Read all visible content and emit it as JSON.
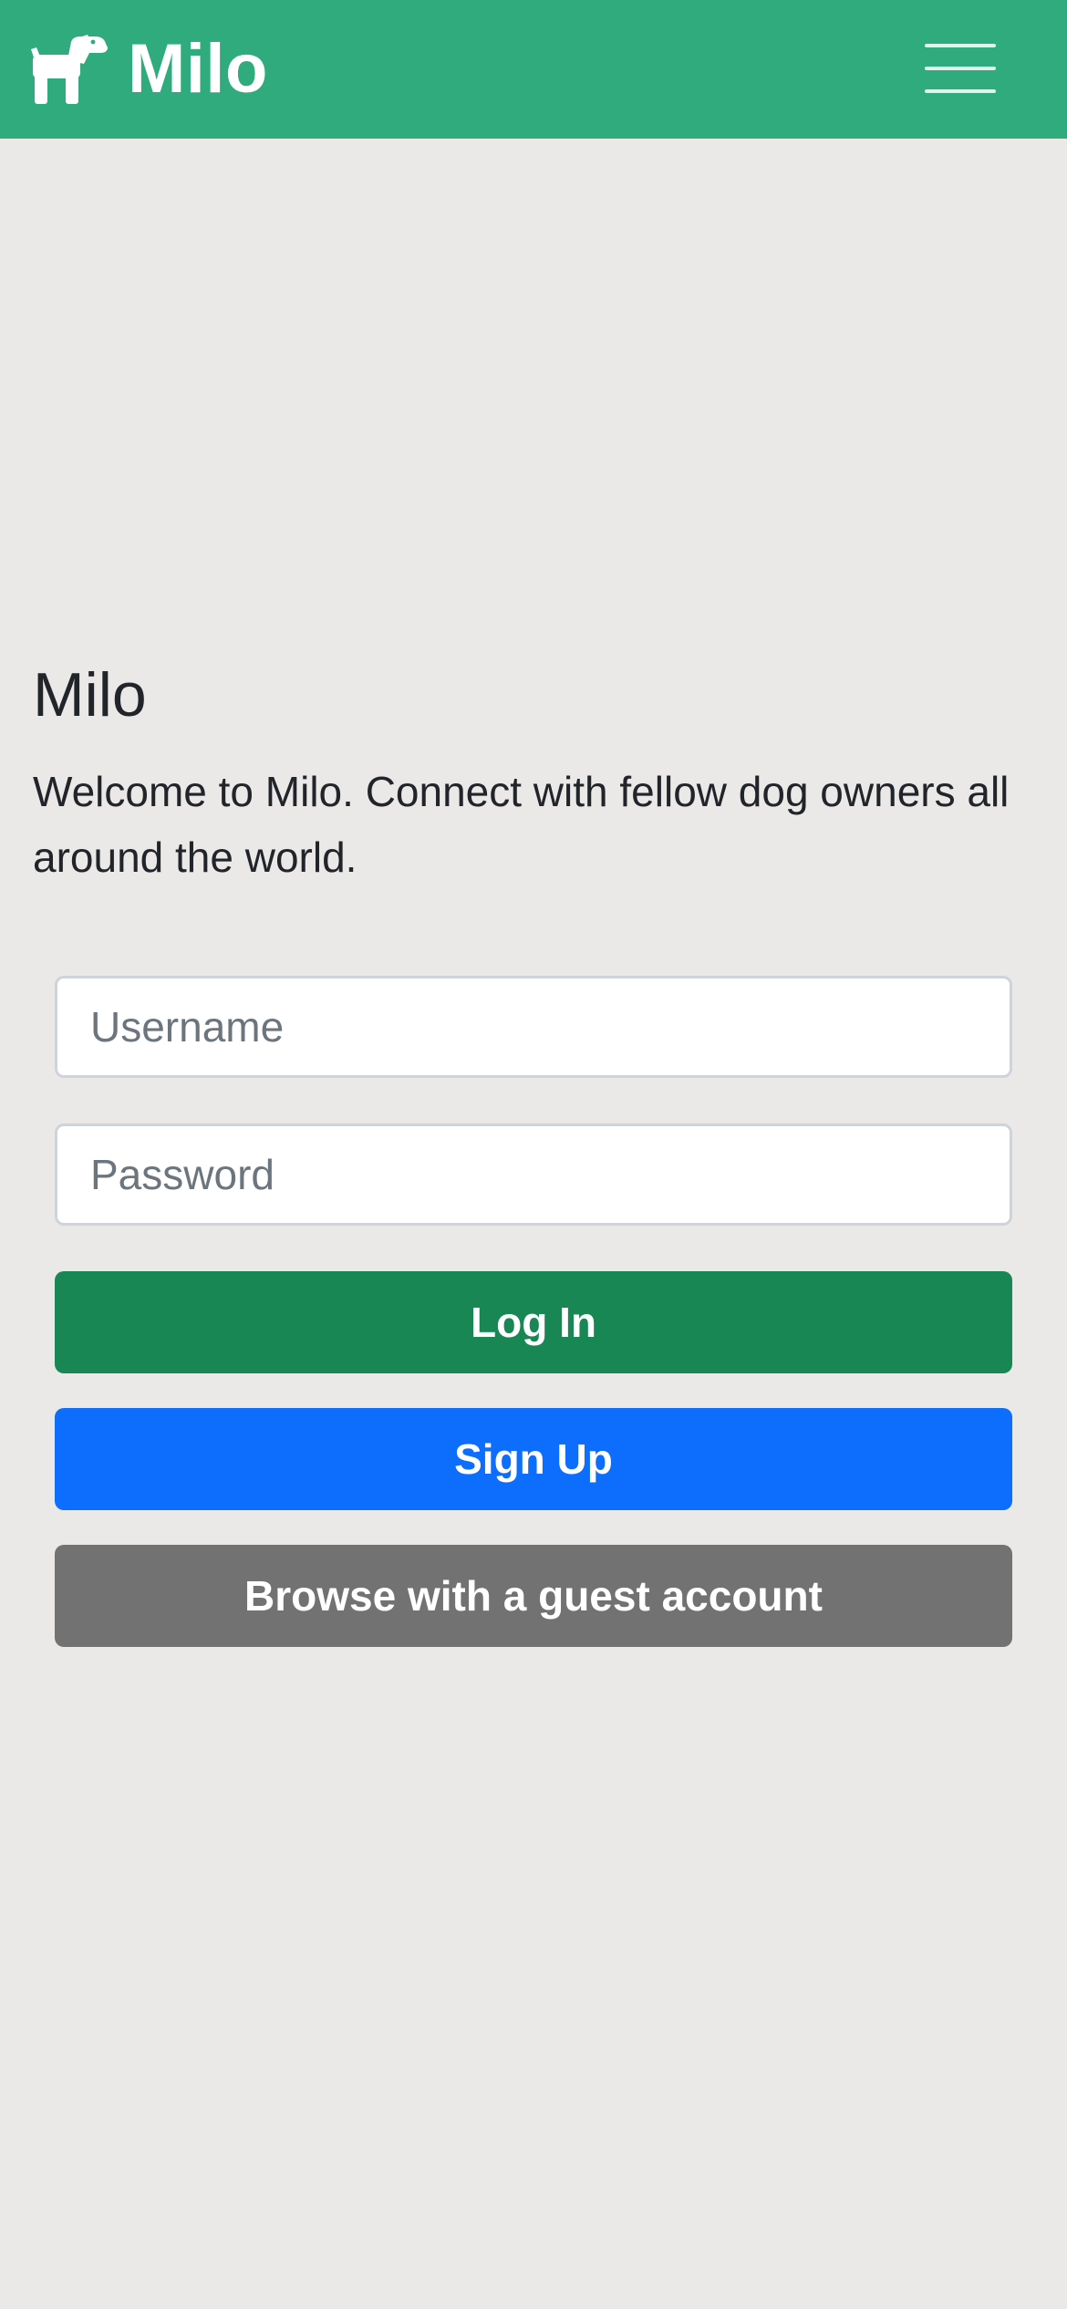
{
  "navbar": {
    "brand": "Milo",
    "brand_icon": "dog-icon",
    "menu_icon": "hamburger-menu-icon",
    "background_color": "#2fab7d"
  },
  "hero": {
    "title": "Milo",
    "description": "Welcome to Milo. Connect with fellow dog owners all around the world."
  },
  "form": {
    "username_placeholder": "Username",
    "username_value": "",
    "password_placeholder": "Password",
    "password_value": ""
  },
  "buttons": {
    "login": {
      "label": "Log In",
      "color": "#198754"
    },
    "signup": {
      "label": "Sign Up",
      "color": "#0d6efd"
    },
    "guest": {
      "label": "Browse with a guest account",
      "color": "#737272"
    }
  }
}
